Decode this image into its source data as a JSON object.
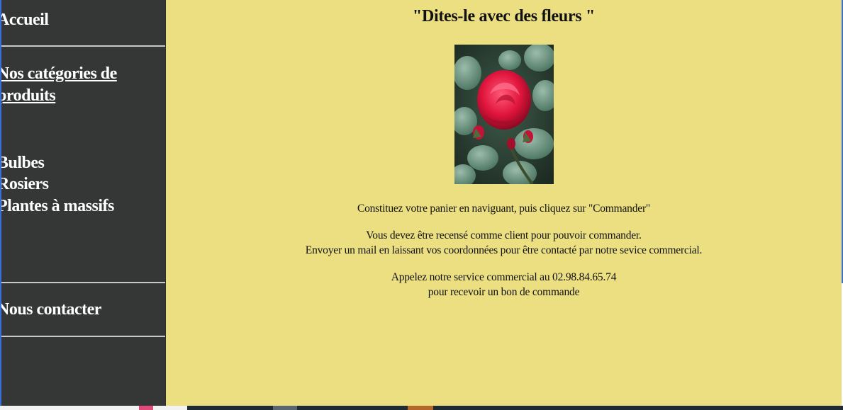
{
  "sidebar": {
    "home": "Accueil",
    "categories_line1": "Nos catégories de",
    "categories_line2": "produits",
    "items": [
      "Bulbes",
      "Rosiers",
      "Plantes à massifs"
    ],
    "contact": "Nous contacter"
  },
  "main": {
    "title": "\"Dites-le avec des fleurs \"",
    "image_alt_icon": "red-rose-photo",
    "para1": "Constituez votre panier en naviguant, puis cliquez sur \"Commander\"",
    "para2_line1": "Vous devez être recensé comme client pour pouvoir commander.",
    "para2_line2": "Envoyer un mail en laissant vos coordonnées pour être contacté par notre sevice commercial.",
    "para3_line1": "Appelez notre service commercial au 02.98.84.65.74",
    "para3_line2": "pour recevoir un bon de commande"
  },
  "colors": {
    "sidebar_bg": "#353636",
    "main_bg": "#ebdf82",
    "rose": "#e0143c",
    "leaves": "#5f8a74"
  }
}
